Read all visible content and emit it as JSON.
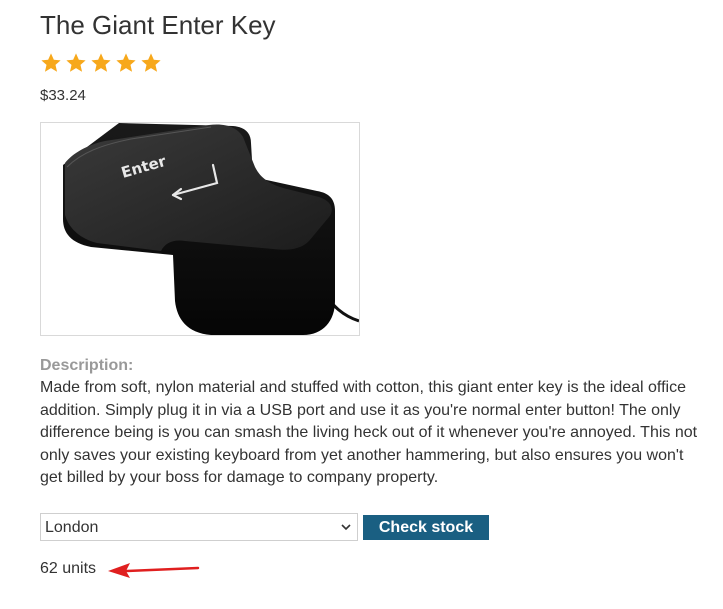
{
  "product": {
    "title": "The Giant Enter Key",
    "rating": 5,
    "rating_max": 5,
    "price": "$33.24",
    "image": {
      "key_label": "Enter",
      "icon": "enter-key-product-icon"
    },
    "description_label": "Description:",
    "description": "Made from soft, nylon material and stuffed with cotton, this giant enter key is the ideal office addition. Simply plug it in via a USB port and use it as you're normal enter button! The only difference being is you can smash the living heck out of it whenever you're annoyed. This not only saves your existing keyboard from yet another hammering, but also ensures you won't get billed by your boss for damage to company property."
  },
  "stock_check": {
    "selected_store": "London",
    "button_label": "Check stock",
    "result": "62 units"
  },
  "colors": {
    "star": "#f7a81b",
    "button": "#1a5f82",
    "arrow": "#e01f1f",
    "label_gray": "#999999"
  }
}
